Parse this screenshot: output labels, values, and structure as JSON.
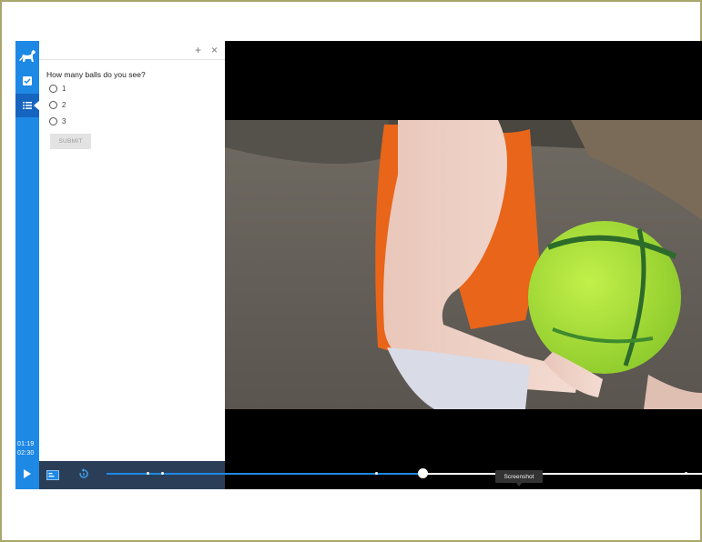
{
  "panel": {
    "add_label": "+",
    "close_label": "×"
  },
  "quiz": {
    "question": "How many balls do you see?",
    "options": [
      "1",
      "2",
      "3"
    ],
    "submit_label": "SUBMIT"
  },
  "rail": {
    "time_current": "01:19",
    "time_total": "02:30"
  },
  "player": {
    "tooltip": "Screenshot",
    "progress_fraction": 0.53
  },
  "colors": {
    "accent": "#1e88e5",
    "accent_dark": "#1565c0",
    "vest": "#e8651a",
    "ball": "#a6e22e"
  },
  "icons": {
    "logo": "dog-logo-icon",
    "check": "checkbox-icon",
    "list": "list-icon",
    "play": "play-icon",
    "caption": "caption-icon",
    "replay": "replay-icon"
  }
}
